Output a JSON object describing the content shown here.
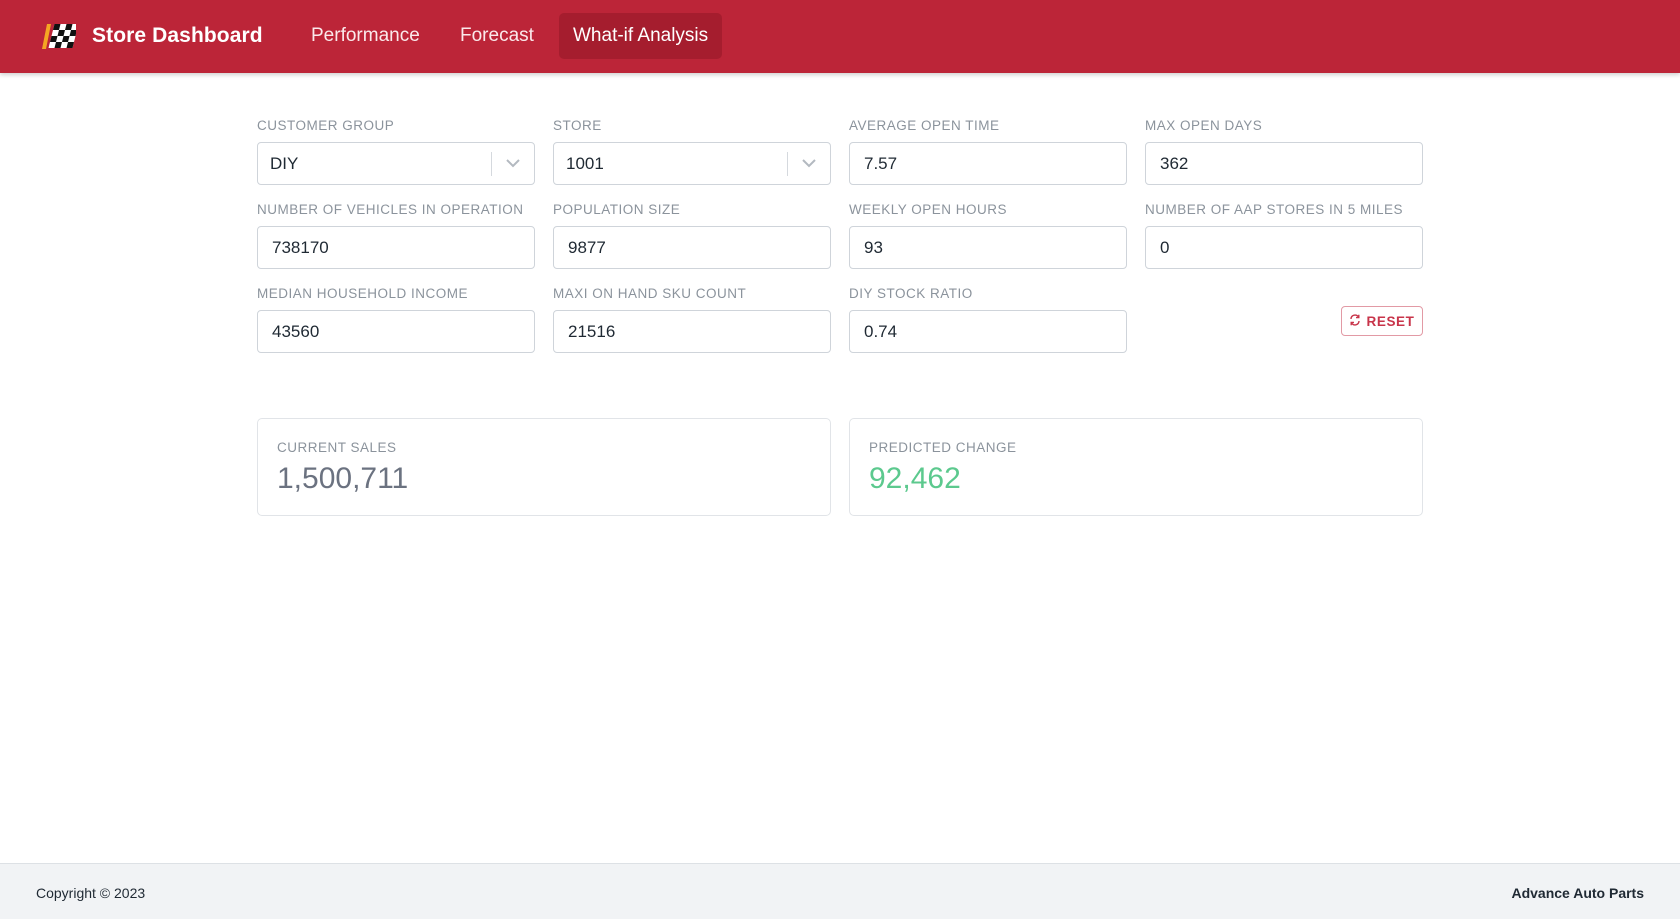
{
  "header": {
    "brand_title": "Store Dashboard",
    "brand_icon": "checkered-flag-icon",
    "nav": [
      {
        "label": "Performance",
        "active": false
      },
      {
        "label": "Forecast",
        "active": false
      },
      {
        "label": "What-if Analysis",
        "active": true
      }
    ],
    "color": "#bc2538"
  },
  "form": {
    "customer_group": {
      "label": "CUSTOMER GROUP",
      "value": "DIY"
    },
    "store": {
      "label": "STORE",
      "value": "1001"
    },
    "average_open_time": {
      "label": "AVERAGE OPEN TIME",
      "value": "7.57"
    },
    "max_open_days": {
      "label": "MAX OPEN DAYS",
      "value": "362"
    },
    "vehicles_in_operation": {
      "label": "NUMBER OF VEHICLES IN OPERATION",
      "value": "738170"
    },
    "population_size": {
      "label": "POPULATION SIZE",
      "value": "9877"
    },
    "weekly_open_hours": {
      "label": "WEEKLY OPEN HOURS",
      "value": "93"
    },
    "aap_stores_5_miles": {
      "label": "NUMBER OF AAP STORES IN 5 MILES",
      "value": "0"
    },
    "median_household_income": {
      "label": "MEDIAN HOUSEHOLD INCOME",
      "value": "43560"
    },
    "maxi_on_hand_sku": {
      "label": "MAXI ON HAND SKU COUNT",
      "value": "21516"
    },
    "diy_stock_ratio": {
      "label": "DIY STOCK RATIO",
      "value": "0.74"
    },
    "reset_label": "RESET"
  },
  "stats": {
    "current_sales": {
      "label": "CURRENT SALES",
      "value": "1,500,711",
      "color": "#6b7280"
    },
    "predicted_change": {
      "label": "PREDICTED CHANGE",
      "value": "92,462",
      "color": "#5cc98e"
    }
  },
  "footer": {
    "copyright": "Copyright © 2023",
    "company": "Advance Auto Parts"
  }
}
